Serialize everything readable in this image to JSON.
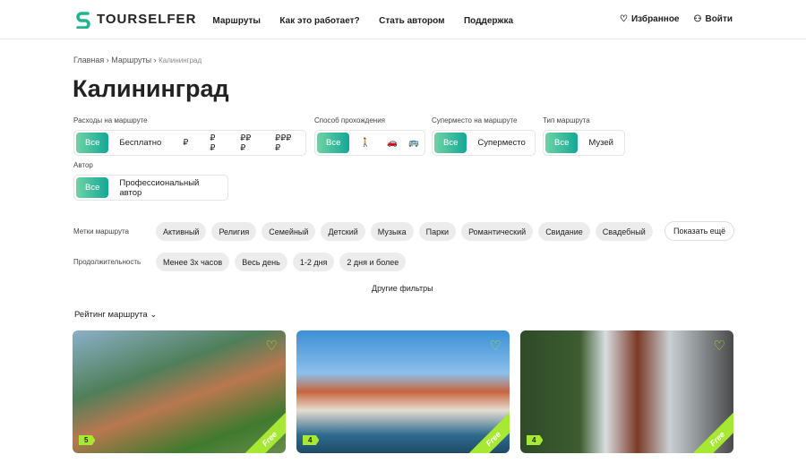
{
  "header": {
    "logo": "TOURSELFER",
    "nav": [
      "Маршруты",
      "Как это работает?",
      "Стать автором",
      "Поддержка"
    ],
    "favorites": "Избранное",
    "login": "Войти"
  },
  "breadcrumb": [
    "Главная",
    "Маршруты",
    "Калининград"
  ],
  "title": "Калининград",
  "filters": {
    "cost": {
      "label": "Расходы на маршруте",
      "options": [
        "Все",
        "Бесплатно",
        "₽",
        "₽₽",
        "₽₽₽",
        "₽₽₽₽"
      ]
    },
    "mode": {
      "label": "Способ прохождения",
      "options": [
        "Все"
      ]
    },
    "superplace": {
      "label": "Суперместо на маршруте",
      "options": [
        "Все",
        "Суперместо"
      ]
    },
    "type": {
      "label": "Тип маршрута",
      "options": [
        "Все",
        "Музей"
      ]
    },
    "author": {
      "label": "Автор",
      "options": [
        "Все",
        "Профессиональный автор"
      ]
    },
    "tags": {
      "label": "Метки маршрута",
      "items": [
        "Активный",
        "Религия",
        "Семейный",
        "Детский",
        "Музыка",
        "Парки",
        "Романтический",
        "Свидание",
        "Свадебный"
      ],
      "more": "Показать ещё"
    },
    "duration": {
      "label": "Продолжительность",
      "items": [
        "Менее 3х часов",
        "Весь день",
        "1-2 дня",
        "2 дня и более"
      ]
    },
    "other": "Другие фильтры"
  },
  "sort": "Рейтинг маршрута ⌄",
  "cards": [
    {
      "rating": "5",
      "free": "Free"
    },
    {
      "rating": "4",
      "free": "Free"
    },
    {
      "rating": "4",
      "free": "Free"
    }
  ]
}
